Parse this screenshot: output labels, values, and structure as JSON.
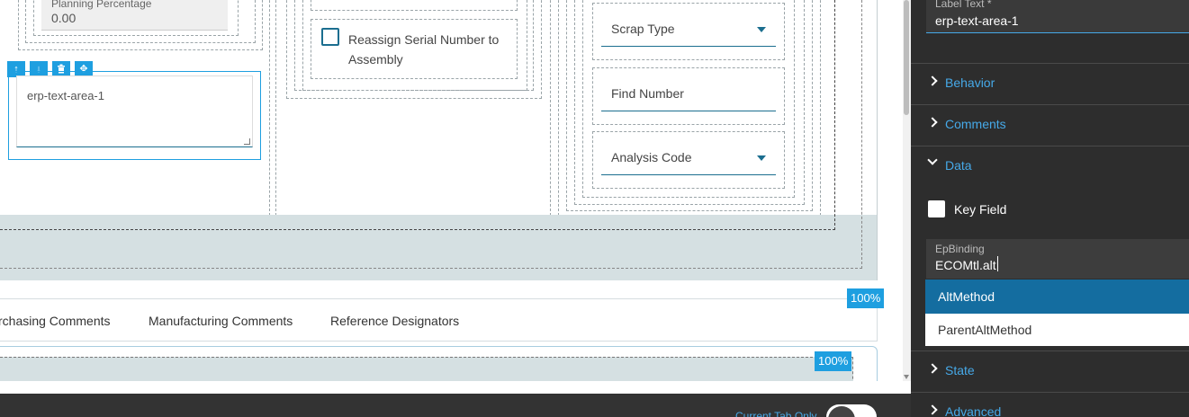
{
  "canvas": {
    "planning_percentage": {
      "label": "Planning Percentage",
      "value": "0.00"
    },
    "toolbar_icons": [
      "arrow-up-icon",
      "arrow-down-icon",
      "trash-icon",
      "move-icon"
    ],
    "text_area": {
      "placeholder": "erp-text-area-1"
    },
    "reassign_checkbox_label": "Reassign Serial Number to Assembly",
    "scrap_type": {
      "label": "Scrap Type"
    },
    "find_number": {
      "label": "Find Number"
    },
    "analysis_code": {
      "label": "Analysis Code"
    },
    "zoom_badges": [
      "100%",
      "100%"
    ],
    "tabs": [
      "rchasing Comments",
      "Manufacturing Comments",
      "Reference Designators"
    ]
  },
  "bottom_bar": {
    "current_tab_only_label": "Current Tab Only"
  },
  "properties": {
    "label_text": {
      "label": "Label Text *",
      "value": "erp-text-area-1"
    },
    "sections": [
      {
        "label": "Behavior",
        "expanded": false
      },
      {
        "label": "Comments",
        "expanded": false
      },
      {
        "label": "Data",
        "expanded": true
      },
      {
        "label": "State",
        "expanded": false
      },
      {
        "label": "Advanced",
        "expanded": false
      }
    ],
    "key_field_label": "Key Field",
    "ep_binding": {
      "label": "EpBinding",
      "value": "ECOMtl.alt",
      "suggestions": [
        "AltMethod",
        "ParentAltMethod"
      ]
    }
  },
  "colors": {
    "accent": "#1e9fe0",
    "panel_bg": "#2d2d2d",
    "link": "#46a9e8",
    "selected": "#146da0"
  }
}
